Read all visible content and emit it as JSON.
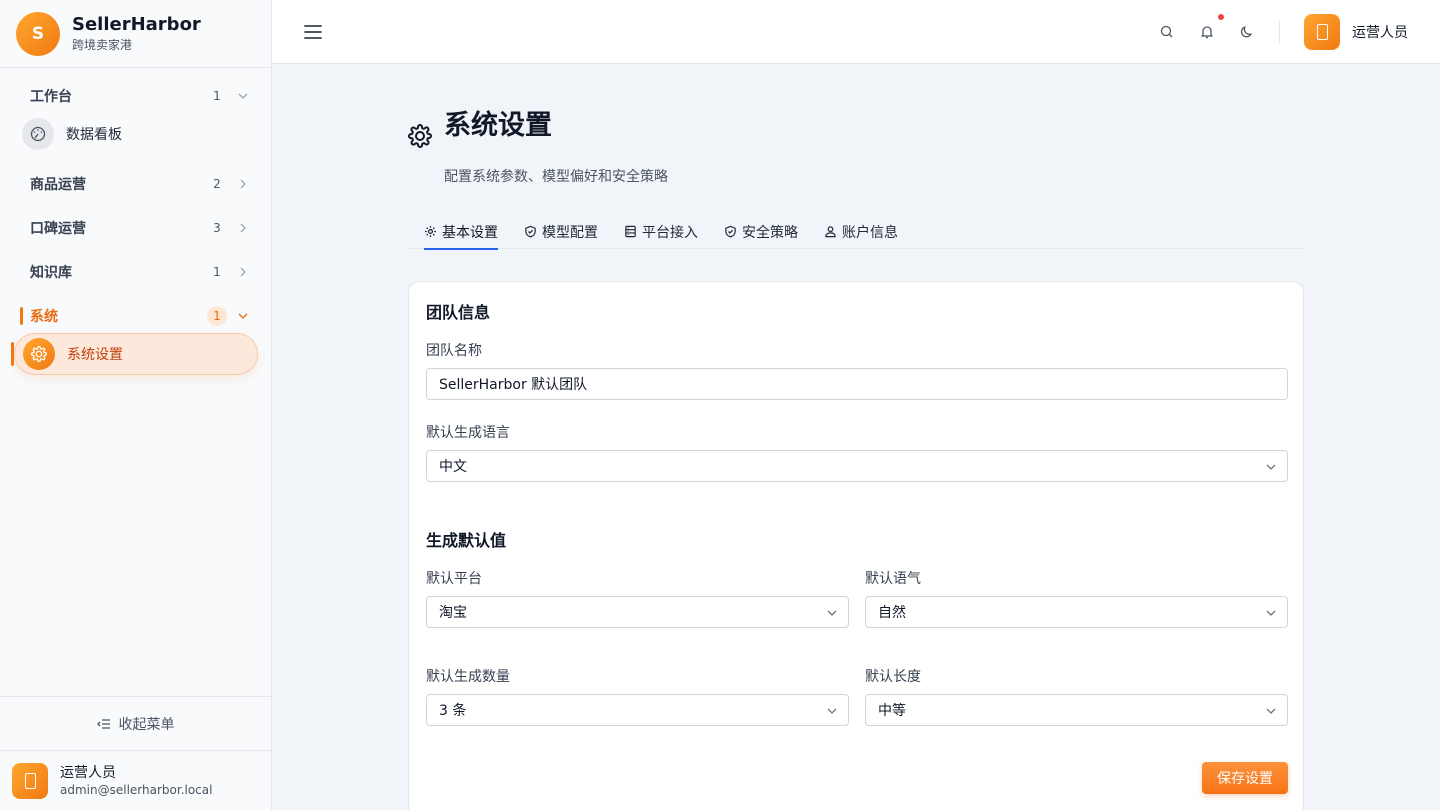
{
  "brand": {
    "logo_letter": "S",
    "name": "SellerHarbor",
    "subtitle": "跨境卖家港"
  },
  "sidebar": {
    "groups": [
      {
        "label": "工作台",
        "count": "1",
        "expanded": true
      },
      {
        "label": "商品运营",
        "count": "2",
        "expanded": false
      },
      {
        "label": "口碑运营",
        "count": "3",
        "expanded": false
      },
      {
        "label": "知识库",
        "count": "1",
        "expanded": false
      },
      {
        "label": "系统",
        "count": "1",
        "expanded": true,
        "active": true
      }
    ],
    "items": [
      {
        "label": "数据看板",
        "icon": "gauge-icon"
      },
      {
        "label": "系统设置",
        "icon": "gear-icon",
        "selected": true
      }
    ],
    "collapse_label": "收起菜单",
    "user": {
      "name": "运营人员",
      "email": "admin@sellerharbor.local"
    }
  },
  "topbar": {
    "user_name": "运营人员",
    "has_notification": true
  },
  "page": {
    "title": "系统设置",
    "subtitle": "配置系统参数、模型偏好和安全策略",
    "tabs": [
      {
        "label": "基本设置",
        "icon": "gear-icon",
        "active": true
      },
      {
        "label": "模型配置",
        "icon": "shield-icon"
      },
      {
        "label": "平台接入",
        "icon": "server-icon"
      },
      {
        "label": "安全策略",
        "icon": "shield-check-icon"
      },
      {
        "label": "账户信息",
        "icon": "user-icon"
      }
    ]
  },
  "form": {
    "team_section": "团队信息",
    "team_name_label": "团队名称",
    "team_name_value": "SellerHarbor 默认团队",
    "language_label": "默认生成语言",
    "language_value": "中文",
    "defaults_section": "生成默认值",
    "platform_label": "默认平台",
    "platform_value": "淘宝",
    "tone_label": "默认语气",
    "tone_value": "自然",
    "count_label": "默认生成数量",
    "count_value": "3 条",
    "length_label": "默认长度",
    "length_value": "中等",
    "save_label": "保存设置"
  },
  "colors": {
    "accent": "#f07a12",
    "tab_indicator": "#2563eb",
    "background": "#f1f4f8"
  }
}
